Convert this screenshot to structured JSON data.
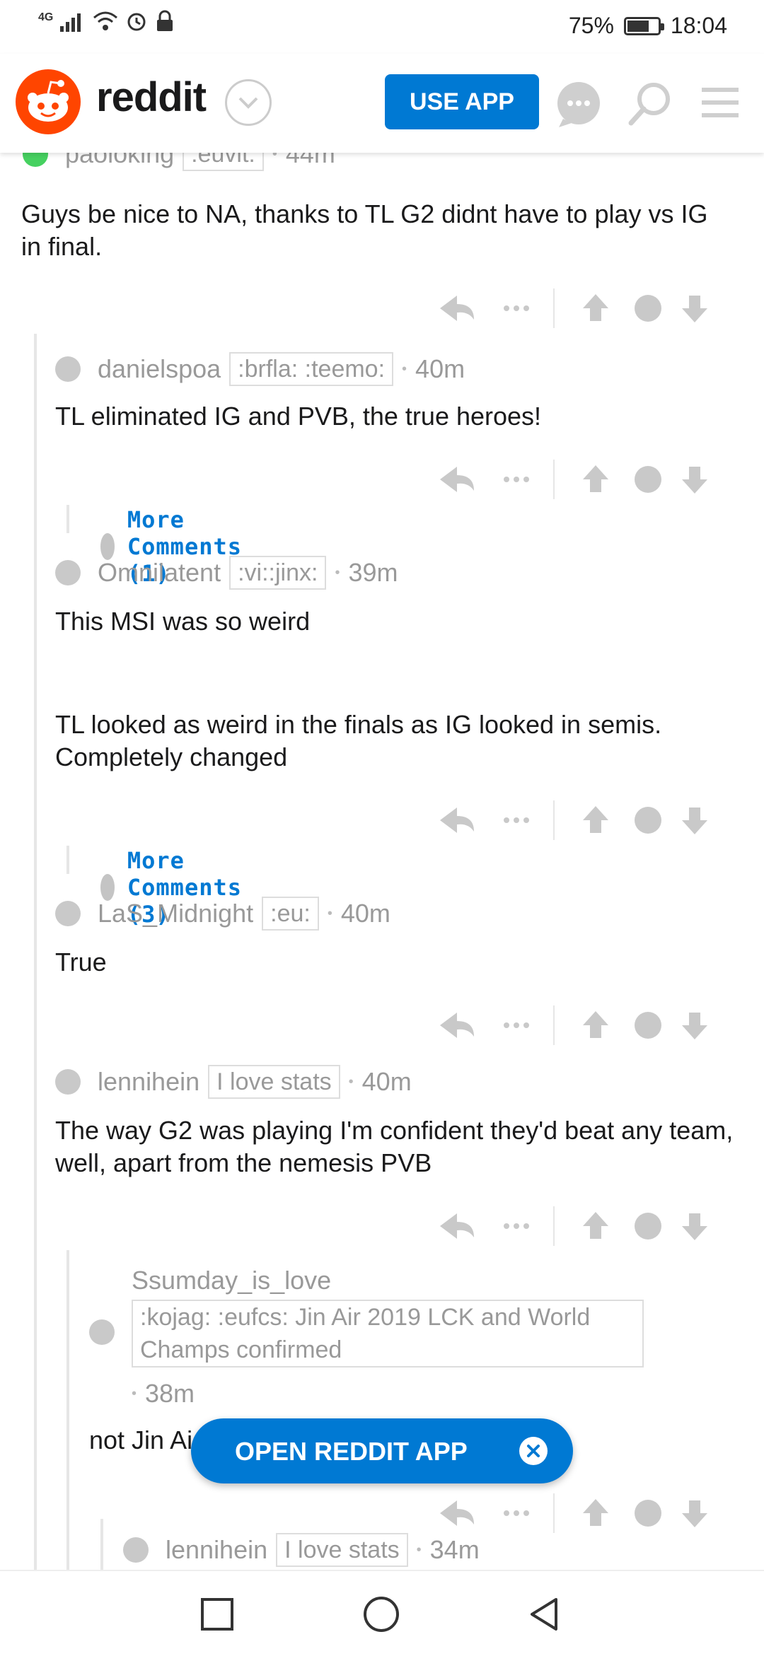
{
  "status": {
    "network": "4G",
    "battery": "75%",
    "battery_level": 0.75,
    "time": "18:04"
  },
  "header": {
    "brand": "reddit",
    "use_app": "USE APP"
  },
  "comments": [
    {
      "user": "paoloking",
      "flair": ":euvit:",
      "time": "44m",
      "body": "Guys be nice to NA, thanks to TL G2 didnt have to play vs IG in final."
    },
    {
      "user": "danielspoa",
      "flair": ":brfla: :teemo:",
      "time": "40m",
      "body": "TL eliminated IG and PVB, the true heroes!"
    },
    {
      "user": "Omnilatent",
      "flair": ":vi::jinx:",
      "time": "39m",
      "body1": "This MSI was so weird",
      "body2": "TL looked as weird in the finals as IG looked in semis. Completely changed"
    },
    {
      "user": "LaS_Midnight",
      "flair": ":eu:",
      "time": "40m",
      "body": "True"
    },
    {
      "user": "lennihein",
      "flair": "I love stats",
      "time": "40m",
      "body": "The way G2 was playing I'm confident they'd beat any team, well, apart from the nemesis PVB"
    },
    {
      "user": "Ssumday_is_love",
      "flair": ":kojag: :eufcs: Jin Air 2019 LCK and World Champs confirmed",
      "time": "38m",
      "body": "not Jin Ai"
    },
    {
      "user": "lennihein",
      "flair": "I love stats",
      "time": "34m"
    }
  ],
  "more_comments": [
    "More Comments (1)",
    "More Comments (3)"
  ],
  "banner": {
    "label": "OPEN REDDIT APP"
  }
}
